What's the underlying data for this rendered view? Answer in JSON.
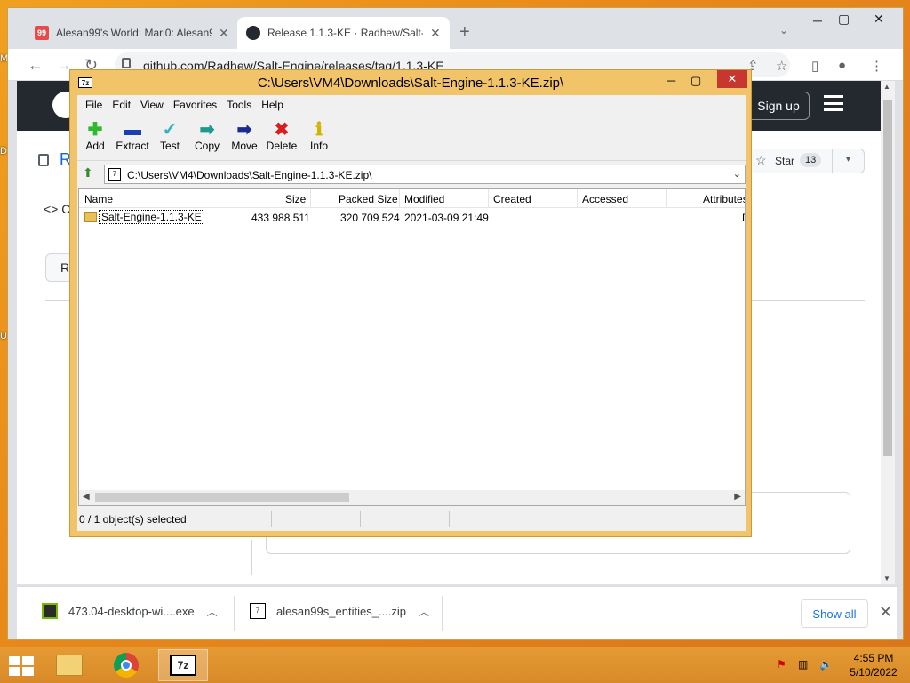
{
  "desktop": {
    "edge_letters": [
      "M",
      "D",
      "U"
    ]
  },
  "chrome": {
    "tabs": [
      {
        "title": "Alesan99's World: Mari0: Alesan99",
        "favicon_text": "99",
        "favicon_color": "#e84a4a"
      },
      {
        "title": "Release 1.1.3-KE · Radhew/Salt-Engine",
        "favicon_text": "",
        "favicon_color": "#24292f"
      }
    ],
    "url": "github.com/Radhew/Salt-Engine/releases/tag/1.1.3-KE"
  },
  "github": {
    "signup_label": "Sign up",
    "repo_initial": "R",
    "star_label": "Star",
    "star_count": "13",
    "code_tab_initial": "C",
    "releases_btn_partial": "Rel"
  },
  "downloads": {
    "items": [
      {
        "name": "473.04-desktop-wi....exe",
        "icon": "nvidia-icon"
      },
      {
        "name": "alesan99s_entities_....zip",
        "icon": "7zip-icon"
      }
    ],
    "show_all": "Show all"
  },
  "zip": {
    "title": "C:\\Users\\VM4\\Downloads\\Salt-Engine-1.1.3-KE.zip\\",
    "app_icon": "7z",
    "menu": [
      "File",
      "Edit",
      "View",
      "Favorites",
      "Tools",
      "Help"
    ],
    "tools": [
      "Add",
      "Extract",
      "Test",
      "Copy",
      "Move",
      "Delete",
      "Info"
    ],
    "address": "C:\\Users\\VM4\\Downloads\\Salt-Engine-1.1.3-KE.zip\\",
    "columns": [
      "Name",
      "Size",
      "Packed Size",
      "Modified",
      "Created",
      "Accessed",
      "Attributes"
    ],
    "rows": [
      {
        "name": "Salt-Engine-1.1.3-KE",
        "size": "433 988 511",
        "packed": "320 709 524",
        "modified": "2021-03-09 21:49",
        "created": "",
        "accessed": "",
        "attributes": "D"
      }
    ],
    "status": "0 / 1 object(s) selected"
  },
  "taskbar": {
    "time": "4:55 PM",
    "date": "5/10/2022",
    "apps": [
      "file-explorer-icon",
      "chrome-icon",
      "7zip-icon"
    ]
  }
}
